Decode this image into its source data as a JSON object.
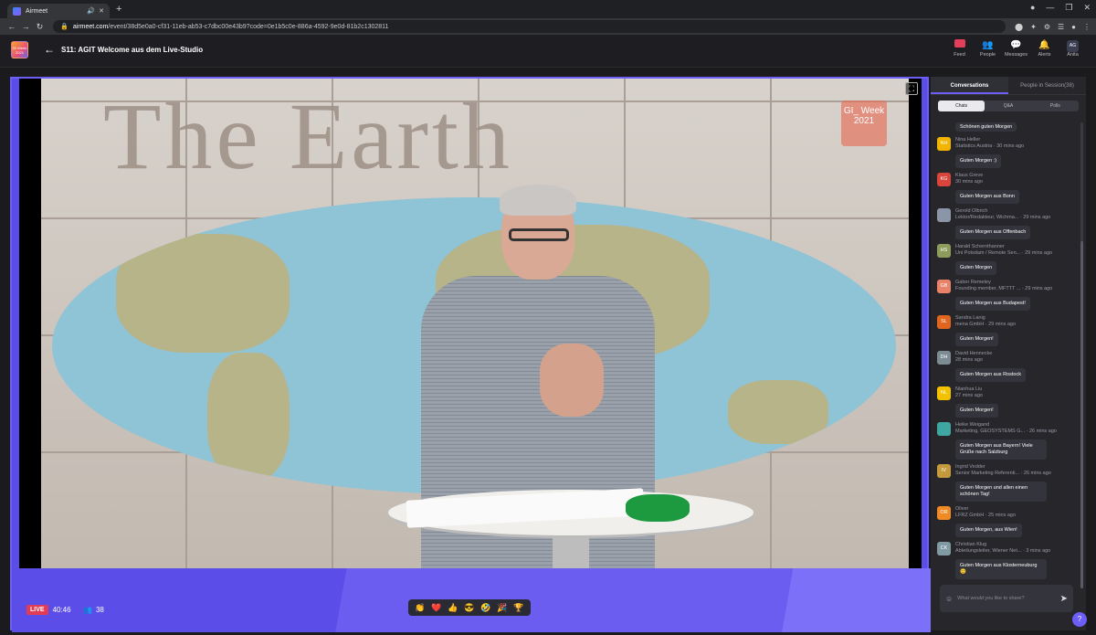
{
  "browser": {
    "tab_title": "Airmeet",
    "tab_audio": "🔊",
    "tab_close": "✕",
    "new_tab": "+",
    "url_domain": "airmeet.com",
    "url_path": "/event/38d5e0a0-cf31-11eb-ab53-c7dbc00e43b9?code=0e1b5c0e-886a-4592-9e0d-81b2c1302811",
    "window_controls": [
      "●",
      "—",
      "❐",
      "✕"
    ],
    "extensions": [
      "⬤",
      "✦",
      "⚙",
      "☰",
      "●",
      "⋮"
    ]
  },
  "app": {
    "logo_text": "GI Week 2021",
    "back": "←",
    "session_title": "S11: AGIT Welcome aus dem Live-Studio",
    "nav": [
      {
        "label": "Feed",
        "icon": "feed-icon"
      },
      {
        "label": "People",
        "icon": "people-icon"
      },
      {
        "label": "Messages",
        "icon": "messages-icon"
      },
      {
        "label": "Alerts",
        "icon": "bell-icon"
      },
      {
        "label": "Anita",
        "avatar": "AG"
      }
    ]
  },
  "stage": {
    "banner_text": "The Earth",
    "overlay_logo": "GI_ Week 2021",
    "live_label": "LIVE",
    "timer": "40:46",
    "attendee_count": "38",
    "reactions": [
      "👏",
      "❤️",
      "👍",
      "😎",
      "🤣",
      "🎉",
      "🏆"
    ]
  },
  "panel": {
    "tabs": [
      "Conversations",
      "People in Session(38)"
    ],
    "subtabs": [
      "Chats",
      "Q&A",
      "Polls"
    ],
    "first_bubble": "Schönen guten Morgen",
    "messages": [
      {
        "initials": "NH",
        "color": "#f3b400",
        "name": "Nina Heller",
        "meta": "Statistics Austria · 30 mins ago",
        "text": "Guten Morgen :)"
      },
      {
        "initials": "KG",
        "color": "#d9453a",
        "name": "Klaus Greve",
        "meta": "30 mins ago",
        "text": "Guten Morgen aus Bonn"
      },
      {
        "initials": "",
        "color": "#8a96a8",
        "name": "Gerold Olbrich",
        "meta": "Lektor/Redakteur, Wichma... · 29 mins ago",
        "text": "Guten Morgen aus Offenbach"
      },
      {
        "initials": "HS",
        "color": "#8d9b5d",
        "name": "Harald Schernthanner",
        "meta": "Uni Potsdam / Remote Sen... · 29 mins ago",
        "text": "Guten Morgen"
      },
      {
        "initials": "GB",
        "color": "#e8836a",
        "name": "Gabor Remetey",
        "meta": "Founding member, MFTTT ... · 29 mins ago",
        "text": "Guten Morgen aus Budapest!"
      },
      {
        "initials": "SL",
        "color": "#e0661f",
        "name": "Sandra Lanig",
        "meta": "mena GmbH · 29 mins ago",
        "text": "Guten Morgen!"
      },
      {
        "initials": "DH",
        "color": "#7d8c93",
        "name": "David Hennecke",
        "meta": "28 mins ago",
        "text": "Guten Morgen aus Rostock"
      },
      {
        "initials": "NL",
        "color": "#f2c200",
        "name": "Nianhua Liu",
        "meta": "27 mins ago",
        "text": "Guten Morgen!"
      },
      {
        "initials": "",
        "color": "#3fa7a1",
        "name": "Heike Weigand",
        "meta": "Marketing, GEOSYSTEMS G... · 26 mins ago",
        "text": "Guten Morgen aus Bayern! Viele Grüße nach Salzburg"
      },
      {
        "initials": "IV",
        "color": "#c49a3d",
        "name": "Ingrid Vedder",
        "meta": "Senior Marketing Referenti... · 26 mins ago",
        "text": "Guten Morgen und allen einen schönen Tag!"
      },
      {
        "initials": "OR",
        "color": "#f08a24",
        "name": "Oliver",
        "meta": "LFRZ GmbH · 25 mins ago",
        "text": "Guten Morgen, aus Wien!"
      },
      {
        "initials": "CK",
        "color": "#7f9aa3",
        "name": "Christian Klug",
        "meta": "Abteilungsleiter, Wiener Net... · 3 mins ago",
        "text": "Guten Morgen aus Klosterneuburg 😊"
      }
    ],
    "composer_placeholder": "What would you like to share?",
    "help": "?"
  }
}
